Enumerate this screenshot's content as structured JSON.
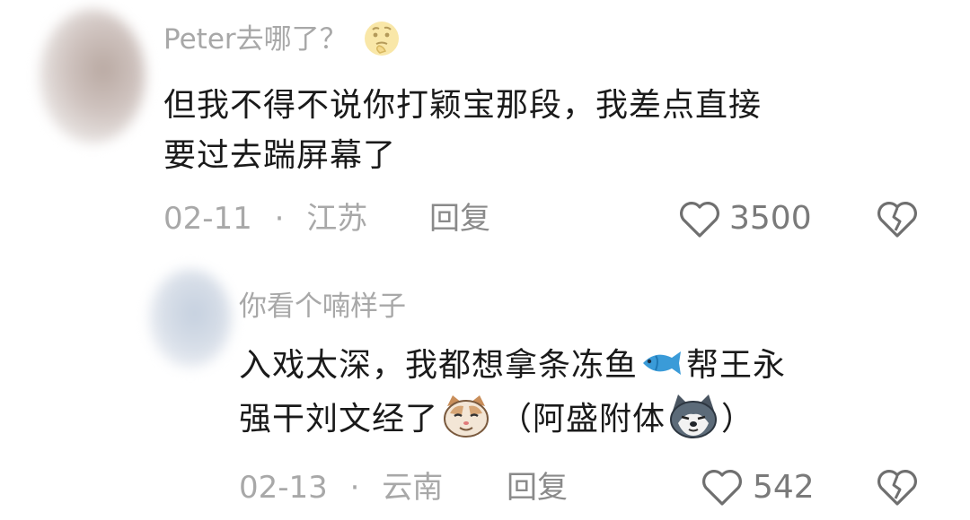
{
  "comments": [
    {
      "username": "Peter去哪了？",
      "username_emoji": "thinking-face-icon",
      "text_line1": "但我不得不说你打颖宝那段，我差点直接",
      "text_line2": "要过去踹屏幕了",
      "date": "02-11",
      "separator": "·",
      "location": "江苏",
      "reply_label": "回复",
      "likes": "3500"
    },
    {
      "username": "你看个喃样子",
      "text_line1_a": "入戏太深，我都想拿条冻鱼",
      "text_line1_b": "帮王永",
      "text_line2_a": "强干刘文经了",
      "text_line2_b": "（阿盛附体",
      "text_line2_c": "）",
      "date": "02-13",
      "separator": "·",
      "location": "云南",
      "reply_label": "回复",
      "likes": "542"
    }
  ],
  "icons": {
    "like": "heart-outline-icon",
    "dislike": "broken-heart-icon",
    "fish": "fish-emoji-icon",
    "cat": "cat-face-emoji-icon",
    "dog": "dog-face-emoji-icon"
  },
  "colors": {
    "text": "#1a1a1a",
    "muted": "#a8a8a8",
    "icon": "#7a7a7a"
  }
}
